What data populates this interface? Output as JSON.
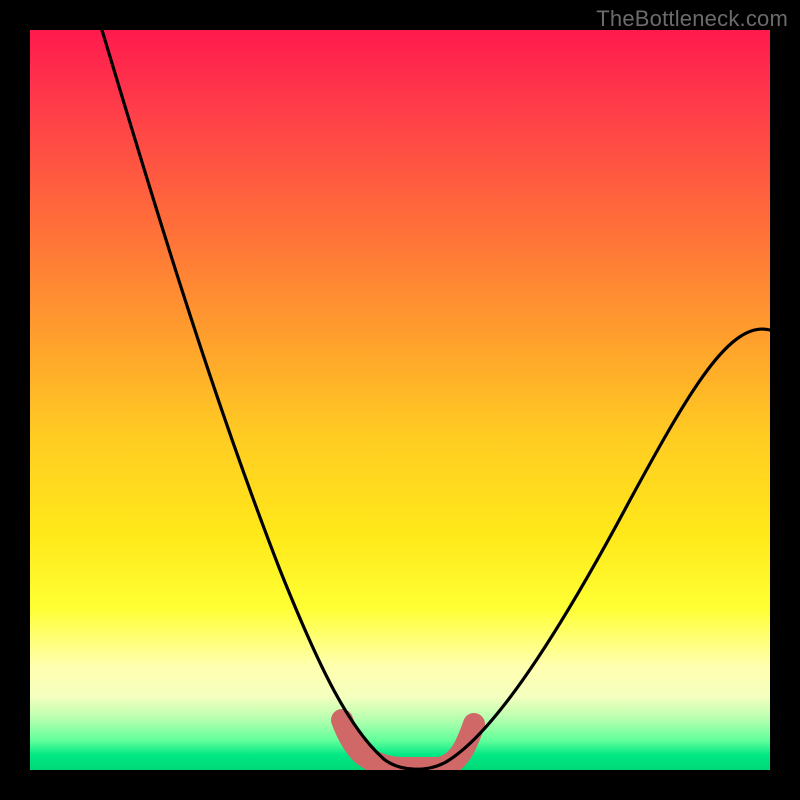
{
  "watermark": "TheBottleneck.com",
  "chart_data": {
    "type": "line",
    "title": "",
    "xlabel": "",
    "ylabel": "",
    "xlim": [
      0,
      100
    ],
    "ylim": [
      0,
      100
    ],
    "series": [
      {
        "name": "bottleneck-curve",
        "x": [
          10,
          15,
          20,
          25,
          30,
          35,
          38,
          40,
          42,
          44,
          46,
          48,
          50,
          55,
          60,
          65,
          70,
          75,
          80,
          85,
          90,
          95,
          100
        ],
        "y": [
          100,
          88,
          76,
          63,
          49,
          34,
          24,
          17,
          11,
          6,
          3,
          1,
          0,
          0,
          3,
          8,
          14,
          21,
          28,
          36,
          44,
          52,
          60
        ]
      },
      {
        "name": "highlight-band",
        "x": [
          44,
          46,
          48,
          50,
          52,
          54,
          56,
          58
        ],
        "y": [
          6,
          3,
          1,
          0,
          0,
          1,
          2,
          4
        ]
      }
    ],
    "colors": {
      "curve": "#000000",
      "highlight": "#d46a6a",
      "gradient_top": "#ff1a4d",
      "gradient_mid": "#ffe81a",
      "gradient_bottom": "#00d877",
      "frame": "#000000"
    }
  }
}
